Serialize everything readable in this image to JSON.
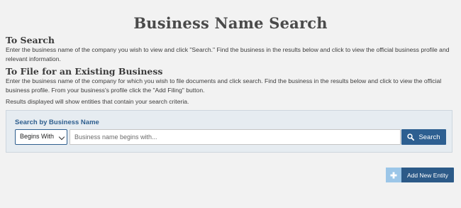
{
  "page": {
    "title": "Business Name Search"
  },
  "sections": {
    "to_search": {
      "heading": "To Search",
      "text": "Enter the business name of the company you wish to view and click \"Search.\" Find the business in the results below and click to view the official business profile and relevant information."
    },
    "to_file": {
      "heading": "To File for an Existing Business",
      "text": "Enter the business name of the company for which you wish to file documents and click search. Find the business in the results below and click to view the official business profile. From your business's profile click the \"Add Filing\" button."
    },
    "results_note": "Results displayed will show entities that contain your search criteria."
  },
  "search": {
    "label": "Search by Business Name",
    "mode_selected": "Begins With",
    "placeholder": "Business name begins with...",
    "value": "",
    "button_label": "Search",
    "search_icon": "search-icon"
  },
  "actions": {
    "add_entity_label": "Add New Entity",
    "add_entity_icon": "plus-icon"
  },
  "colors": {
    "accent": "#2d5f91",
    "panel_bg": "#e6ecf1",
    "page_bg": "#f2f2f2",
    "add_icon_bg": "#9cc6e8"
  }
}
